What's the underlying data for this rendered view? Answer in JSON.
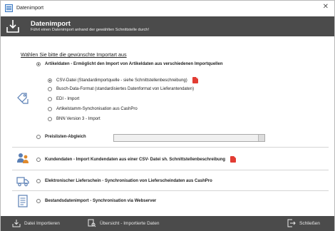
{
  "window": {
    "title": "Datenimport",
    "close_glyph": "✕"
  },
  "banner": {
    "title": "Datenimport",
    "subtitle": "Führt einen Datenimport anhand der gewählten Schnittstelle durch!",
    "icon": "import-arrow-icon"
  },
  "prompt": "Wählen Sie bitte die gewünschte Importart aus",
  "groups": {
    "artikeldaten": {
      "label": "Artikeldaten - Ermöglicht den Import von Artikeldaten aus verschiedenen Importquellen",
      "selected": true,
      "options": [
        {
          "label": "CSV-Datei (Standardimportquelle - siehe Schnittstellenbeschreibung)",
          "selected": true,
          "has_pdf": true
        },
        {
          "label": "Busch-Data-Format (standardisiertes Datenformat von Lieferantendaten)",
          "selected": false
        },
        {
          "label": "EDI - Import",
          "selected": false
        },
        {
          "label": "Artikelstamm-Synchonisation aus CashPro",
          "selected": false
        },
        {
          "label": "BNN Version 3 - Import",
          "selected": false
        }
      ]
    },
    "preislisten": {
      "label": "Preislisten-Abgleich",
      "selected": false,
      "dropdown_value": ""
    },
    "kunden": {
      "label": "Kundendaten - Import Kundendaten aus einer CSV- Datei sh. Schnittstellenbeschreibung",
      "selected": false
    },
    "lieferschein": {
      "label": "Elektronischer Lieferschein - Synchronisation von Lieferscheindaten aus CashPro",
      "selected": false
    },
    "bestand": {
      "label": "Bestandsdatenimport - Synchronisation via Webserver",
      "selected": false
    }
  },
  "footer": {
    "import_label": "Datei Importieren",
    "overview_label": "Übersicht - Importierte Daten",
    "close_label": "Schließen"
  },
  "colors": {
    "dark_bar": "#4b4b4b",
    "pdf_red": "#e23c33",
    "icon_blue": "#5a7fb5"
  }
}
